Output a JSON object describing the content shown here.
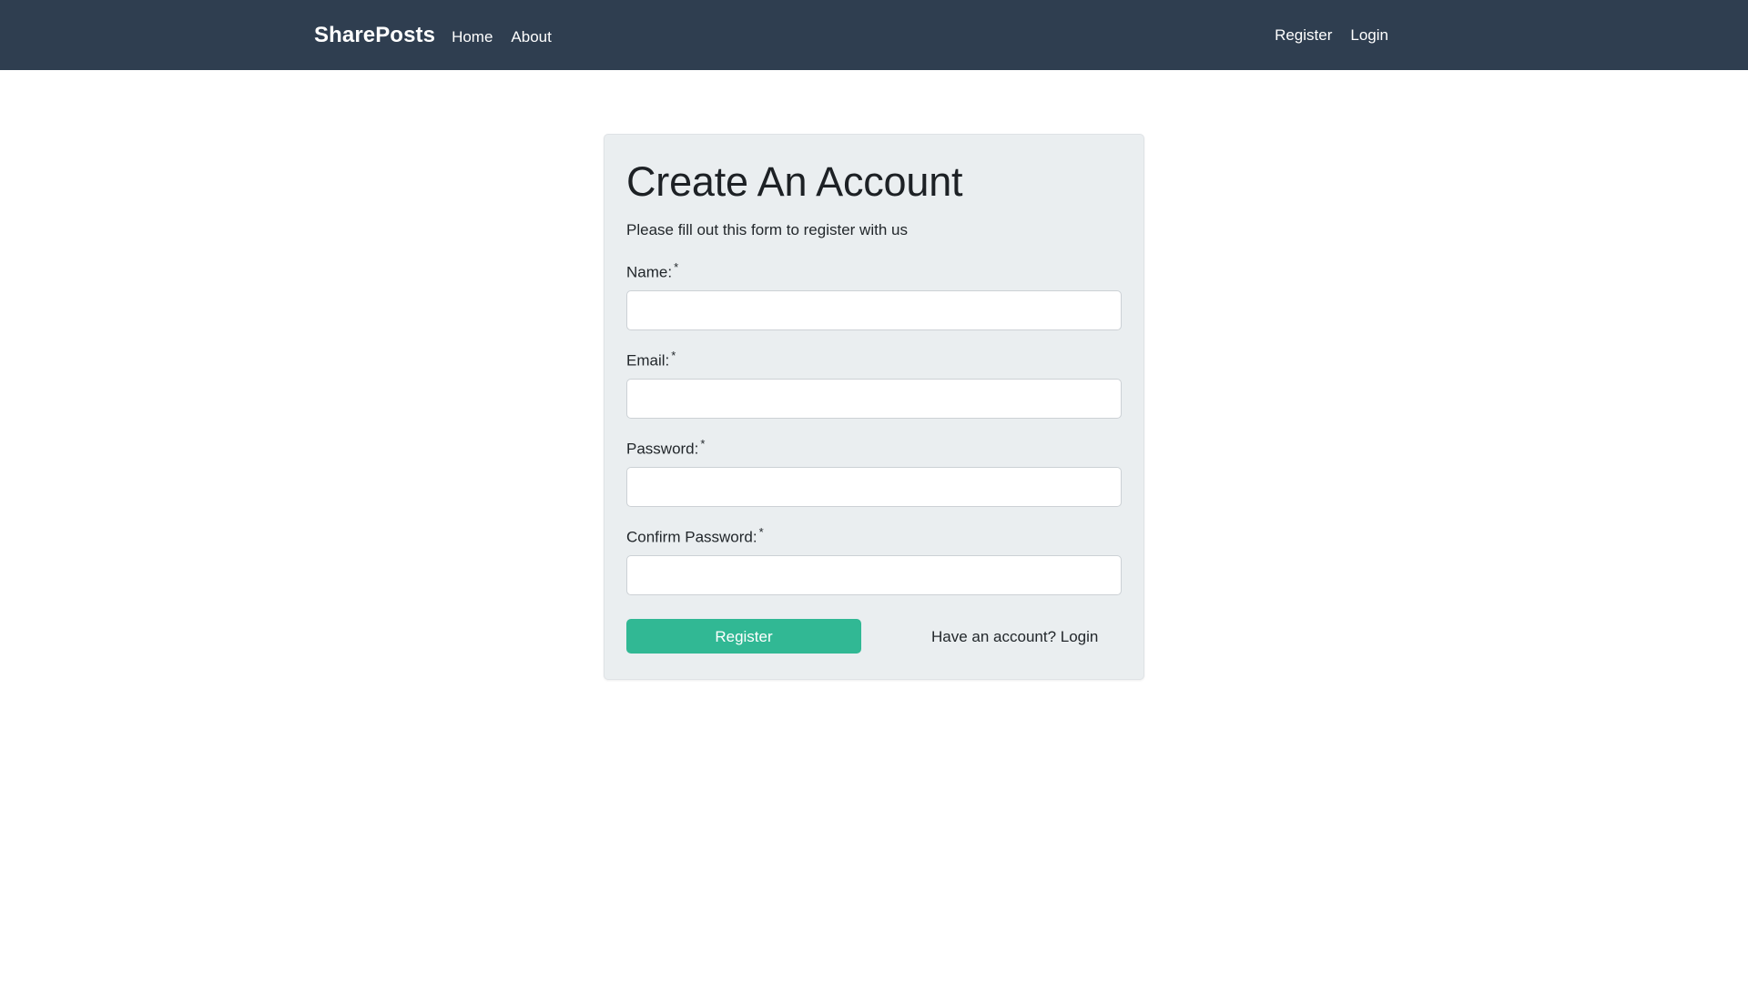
{
  "navbar": {
    "brand": "SharePosts",
    "left_links": [
      {
        "label": "Home"
      },
      {
        "label": "About"
      }
    ],
    "right_links": [
      {
        "label": "Register"
      },
      {
        "label": "Login"
      }
    ],
    "background_color": "#2f3e50",
    "text_color": "#ffffff"
  },
  "card": {
    "title": "Create An Account",
    "subtitle": "Please fill out this form to register with us",
    "background_color": "#eaeef0",
    "border_color": "#dfe3e6"
  },
  "form": {
    "required_mark": "*",
    "fields": [
      {
        "label": "Name:",
        "value": "",
        "placeholder": "",
        "type": "text",
        "required": true
      },
      {
        "label": "Email:",
        "value": "",
        "placeholder": "",
        "type": "text",
        "required": true
      },
      {
        "label": "Password:",
        "value": "",
        "placeholder": "",
        "type": "password",
        "required": true
      },
      {
        "label": "Confirm Password:",
        "value": "",
        "placeholder": "",
        "type": "password",
        "required": true
      }
    ],
    "submit_label": "Register",
    "submit_color": "#31b894",
    "login_hint": "Have an account? Login"
  }
}
